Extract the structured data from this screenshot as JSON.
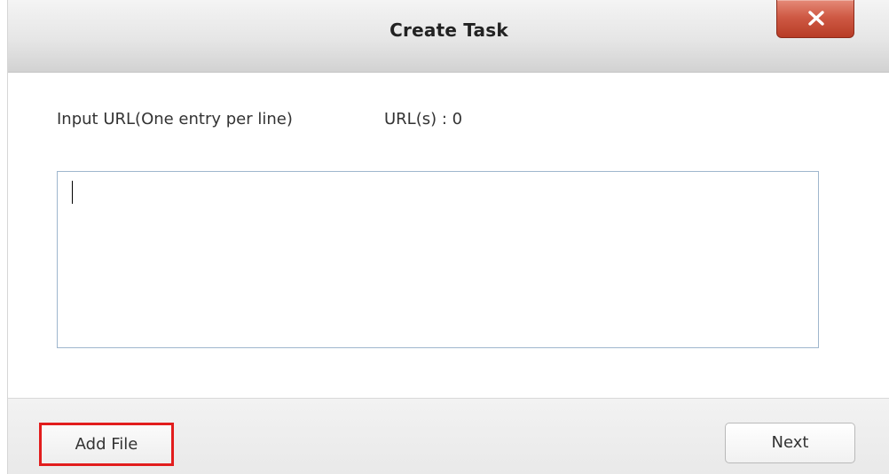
{
  "dialog": {
    "title": "Create Task",
    "close_icon": "close-x-icon"
  },
  "form": {
    "url_label": "Input URL(One entry per line)",
    "url_count": "URL(s) : 0",
    "url_input_value": ""
  },
  "footer": {
    "add_file_label": "Add File",
    "next_label": "Next"
  },
  "colors": {
    "close_button": "#cf5a45",
    "highlight_border": "#e21d1d",
    "input_border": "#9fb6cd"
  }
}
